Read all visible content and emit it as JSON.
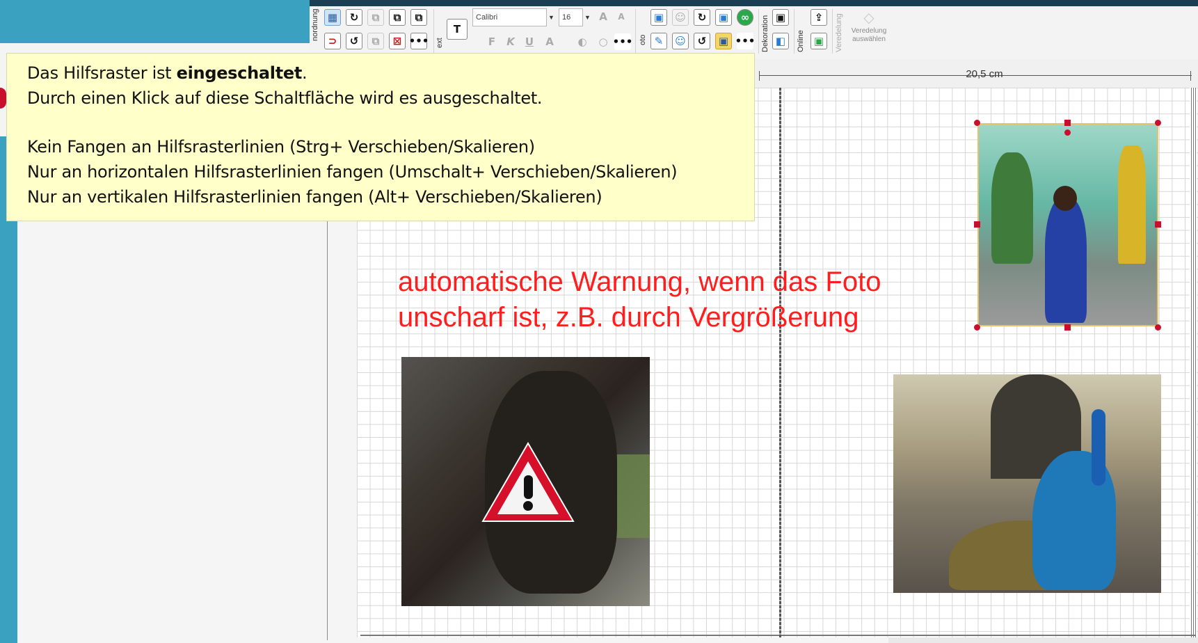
{
  "ribbon": {
    "groups": [
      "nordnung",
      "ext",
      "oto",
      "Dekoration",
      "Online",
      "Veredelung"
    ],
    "font_name": "Calibri",
    "font_size": "16",
    "format_buttons": [
      "F",
      "K",
      "U"
    ],
    "veredelung_button": "Veredelung auswählen",
    "veredelung_line1": "Veredelung",
    "veredelung_line2": "auswählen"
  },
  "ruler": {
    "label": "20,5 cm"
  },
  "tooltip": {
    "line1_prefix": "Das Hilfsraster ist ",
    "line1_bold": "eingeschaltet",
    "line1_suffix": ".",
    "line2": "Durch einen Klick auf diese Schaltfläche wird es ausgeschaltet.",
    "line3": "Kein Fangen an Hilfsrasterlinien (Strg+ Verschieben/Skalieren)",
    "line4": "Nur an horizontalen Hilfsrasterlinien fangen (Umschalt+ Verschieben/Skalieren)",
    "line5": "Nur an vertikalen Hilfsrasterlinien fangen (Alt+ Verschieben/Skalieren)"
  },
  "annotation": {
    "line1": "automatische Warnung, wenn das Foto",
    "line2": "unscharf ist, z.B. durch Vergrößerung"
  },
  "panel": {
    "collapse_glyph": "»"
  },
  "colors": {
    "background": "#3aa2c0",
    "annotation": "#ff1d1d",
    "tooltip": "#ffffc9",
    "warning": "#d6102b"
  }
}
